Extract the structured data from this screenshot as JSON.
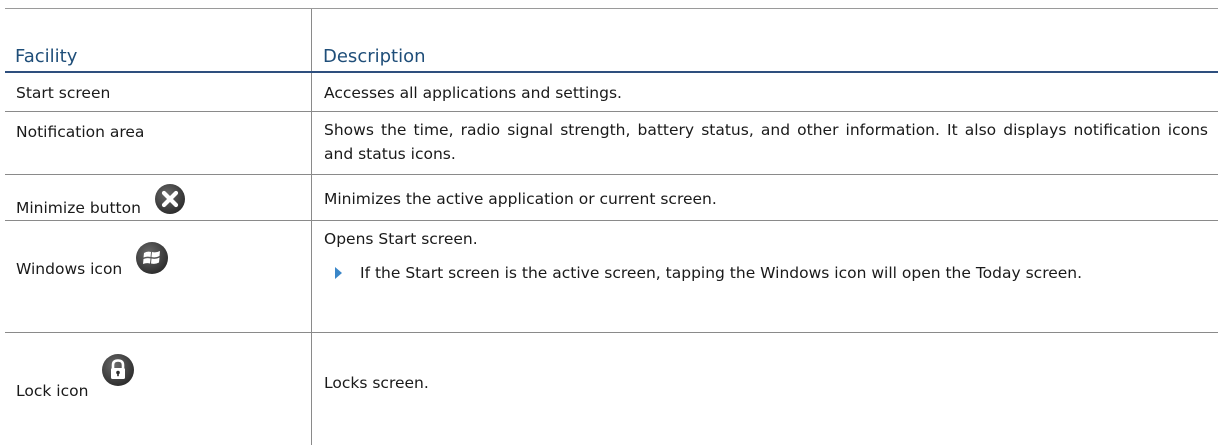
{
  "header": {
    "facility": "Facility",
    "description": "Description"
  },
  "rows": [
    {
      "facility": "Start screen",
      "description": "Accesses all applications and settings."
    },
    {
      "facility": "Notification area",
      "description": "Shows the time, radio signal strength, battery status, and other information. It also displays notification icons and status icons."
    },
    {
      "facility": "Minimize button",
      "icon": "close-x-icon",
      "description": "Minimizes the active application or current screen."
    },
    {
      "facility": "Windows icon",
      "icon": "windows-logo-icon",
      "description": "Opens Start screen.",
      "bullet": "If the Start screen is the active screen, tapping the Windows icon will open the Today screen."
    },
    {
      "facility": "Lock icon",
      "icon": "padlock-icon",
      "description": "Locks screen."
    }
  ],
  "colors": {
    "header_text": "#1f4e79",
    "header_rule": "#2e4f7e",
    "bullet": "#3a86c8",
    "icon_fill": "#3c3c3c"
  }
}
